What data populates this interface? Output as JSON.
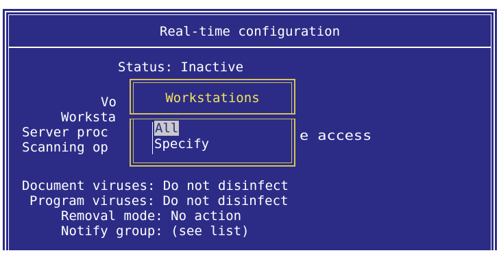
{
  "window": {
    "title": "Real-time configuration"
  },
  "settings": {
    "status_label": "Status: Inactive",
    "volumes_frag": "Vo",
    "workstations_frag": "Worksta",
    "server_frag": "Server proc",
    "server_tail": "e access",
    "scanning_frag": "Scanning op",
    "document_viruses": "Document viruses: Do not disinfect",
    "program_viruses": "Program viruses: Do not disinfect",
    "removal_mode": "Removal mode: No action",
    "notify_group": "Notify group: (see list)"
  },
  "popup": {
    "title": "Workstations",
    "options": [
      "All",
      "Specify"
    ],
    "selected": "All"
  },
  "colors": {
    "background": "#2c2c87",
    "text": "#ffffff",
    "popup_border": "#d7c35a",
    "popup_title": "#f2e25a",
    "selection": "#c9c9c9"
  }
}
